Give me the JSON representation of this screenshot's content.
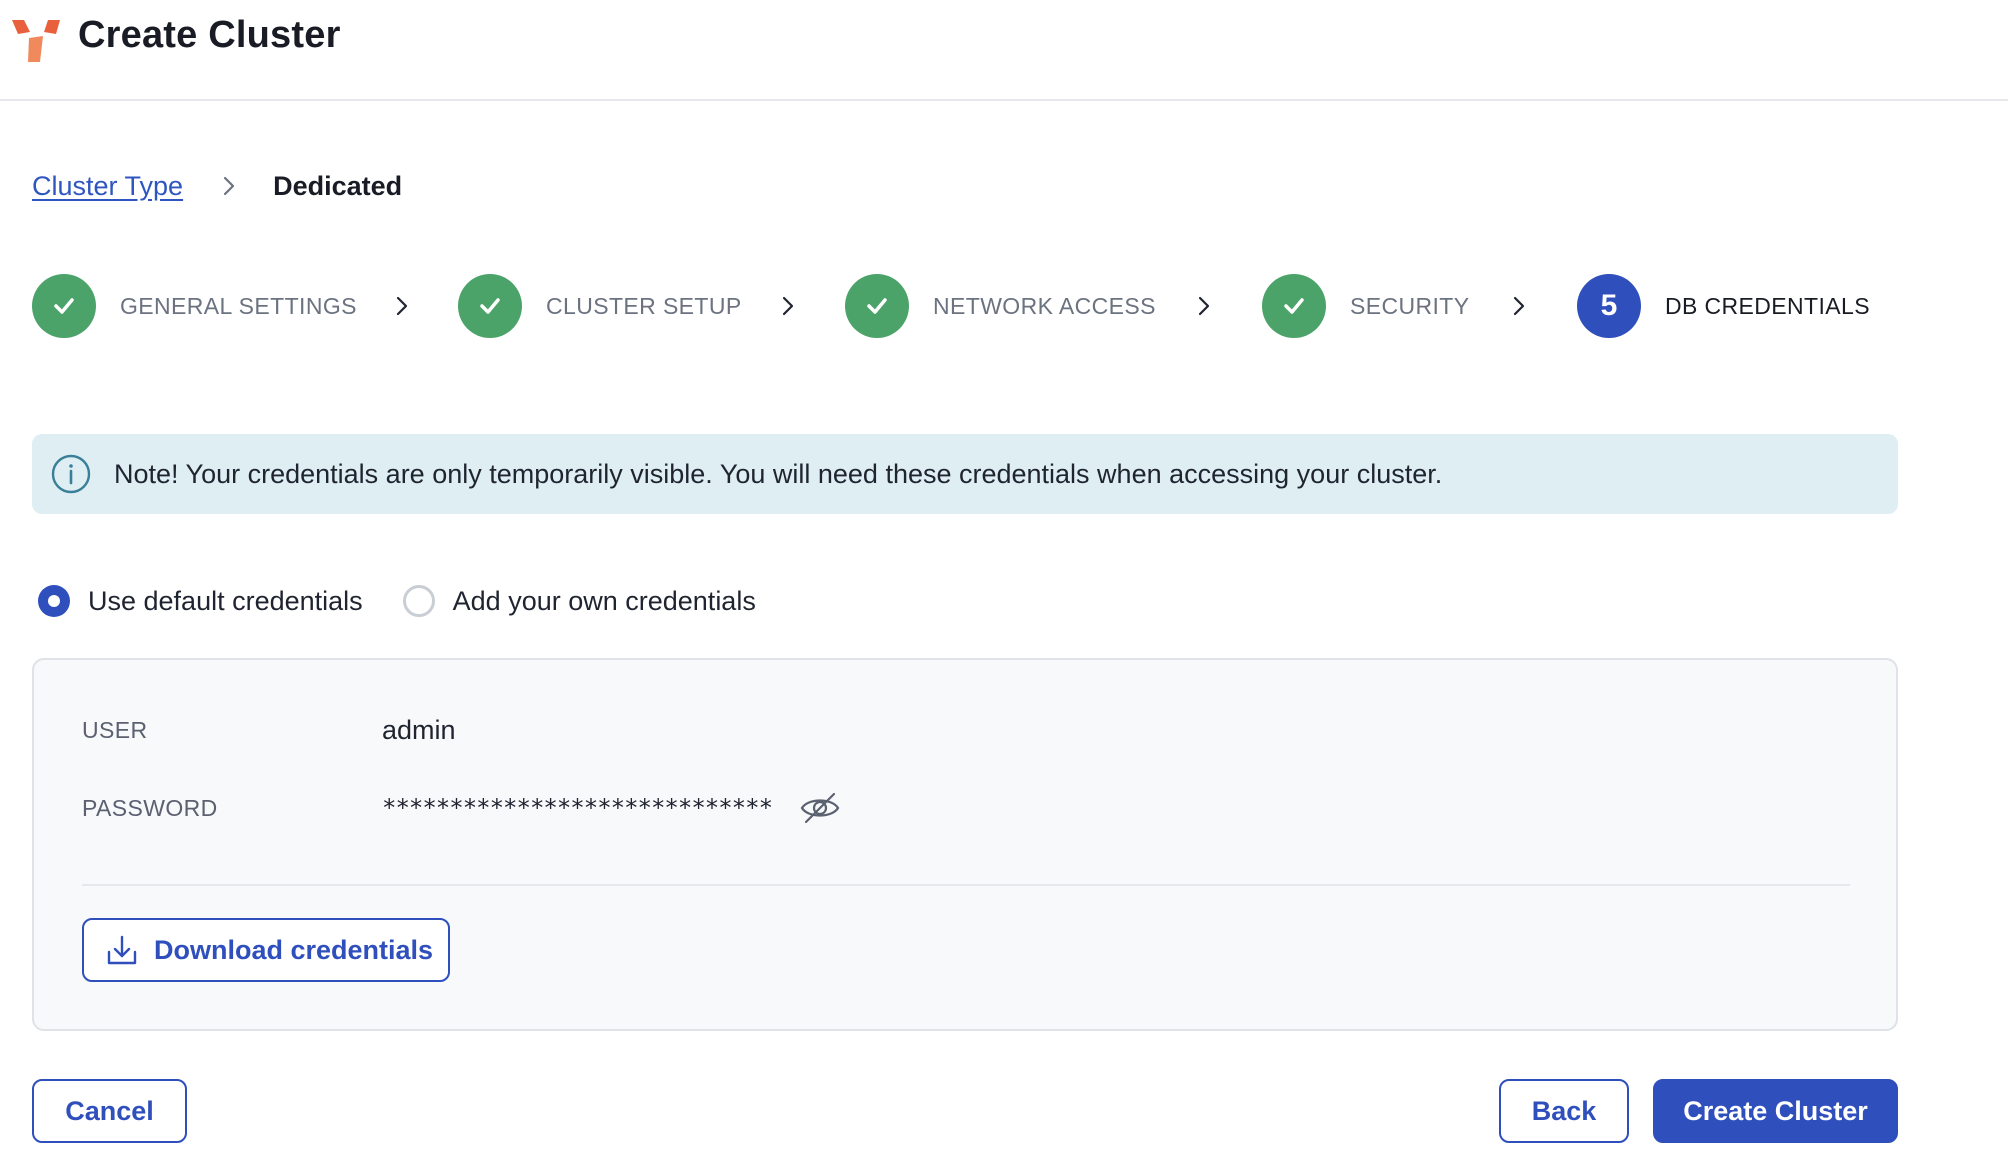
{
  "header": {
    "title": "Create Cluster",
    "logo_colors": [
      "#e8603c",
      "#f08a5d"
    ]
  },
  "breadcrumb": {
    "link_label": "Cluster Type",
    "current_label": "Dedicated"
  },
  "stepper": {
    "steps": [
      {
        "label": "GENERAL SETTINGS",
        "status": "complete"
      },
      {
        "label": "CLUSTER SETUP",
        "status": "complete"
      },
      {
        "label": "NETWORK ACCESS",
        "status": "complete"
      },
      {
        "label": "SECURITY",
        "status": "complete"
      },
      {
        "label": "DB CREDENTIALS",
        "status": "active",
        "number": "5"
      }
    ]
  },
  "notice": {
    "text": "Note! Your credentials are only temporarily visible. You will need these credentials when accessing your cluster."
  },
  "credential_options": {
    "default_label": "Use default credentials",
    "custom_label": "Add your own credentials",
    "selected": "default"
  },
  "credentials": {
    "user_label": "USER",
    "user_value": "admin",
    "password_label": "PASSWORD",
    "password_value": "*****************************",
    "download_label": "Download credentials"
  },
  "footer": {
    "cancel_label": "Cancel",
    "back_label": "Back",
    "create_label": "Create Cluster"
  },
  "colors": {
    "primary": "#2f4fbd",
    "success": "#4ba36a",
    "info_bg": "#deeef3",
    "panel_bg": "#f8f9fb"
  }
}
